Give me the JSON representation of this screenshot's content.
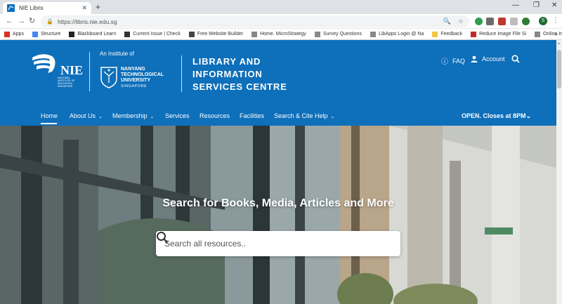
{
  "browser": {
    "tab_title": "NIE Libris",
    "url": "https://libris.nie.edu.sg",
    "profile_initial": "S",
    "bookmarks": [
      {
        "label": "Apps",
        "icon": "apps-grid-icon",
        "color": "#d93025"
      },
      {
        "label": "Structure",
        "icon": "structure-icon",
        "color": "#4285f4"
      },
      {
        "label": "Blackboard Learn",
        "icon": "blackboard-icon",
        "color": "#222222"
      },
      {
        "label": "Current Issue | Check",
        "icon": "current-issue-icon",
        "color": "#333333"
      },
      {
        "label": "Free Website Builder",
        "icon": "website-builder-icon",
        "color": "#444444"
      },
      {
        "label": "Home. MicroStrategy",
        "icon": "page-icon",
        "color": "#888888"
      },
      {
        "label": "Survey Questions",
        "icon": "page-icon",
        "color": "#888888"
      },
      {
        "label": "LibApps Login @ Na",
        "icon": "page-icon",
        "color": "#888888"
      },
      {
        "label": "Feedback",
        "icon": "folder-icon",
        "color": "#f5c542"
      },
      {
        "label": "Reduce Image File Si",
        "icon": "reduce-image-icon",
        "color": "#c62828"
      },
      {
        "label": "Online Image Editor |",
        "icon": "page-icon",
        "color": "#888888"
      }
    ]
  },
  "header": {
    "institute_of": "An Institute of",
    "ntu_lines": [
      "NANYANG",
      "TECHNOLOGICAL",
      "UNIVERSITY"
    ],
    "ntu_country": "SINGAPORE",
    "nie_sub": [
      "NATIONAL",
      "INSTITUTE OF",
      "EDUCATION",
      "SINGAPORE"
    ],
    "library_title": [
      "LIBRARY AND",
      "INFORMATION",
      "SERVICES CENTRE"
    ],
    "faq_label": "FAQ",
    "account_label": "Account"
  },
  "nav": {
    "items": [
      {
        "label": "Home",
        "caret": false
      },
      {
        "label": "About Us",
        "caret": true
      },
      {
        "label": "Membership",
        "caret": true
      },
      {
        "label": "Services",
        "caret": false
      },
      {
        "label": "Resources",
        "caret": false
      },
      {
        "label": "Facilities",
        "caret": false
      },
      {
        "label": "Search & Cite Help",
        "caret": true
      }
    ],
    "status": "OPEN. Closes at 8PM"
  },
  "hero": {
    "heading": "Search for Books, Media, Articles and More",
    "search_placeholder": "Search all resources.."
  },
  "colors": {
    "brand_blue": "#0e6fba",
    "white": "#ffffff"
  }
}
